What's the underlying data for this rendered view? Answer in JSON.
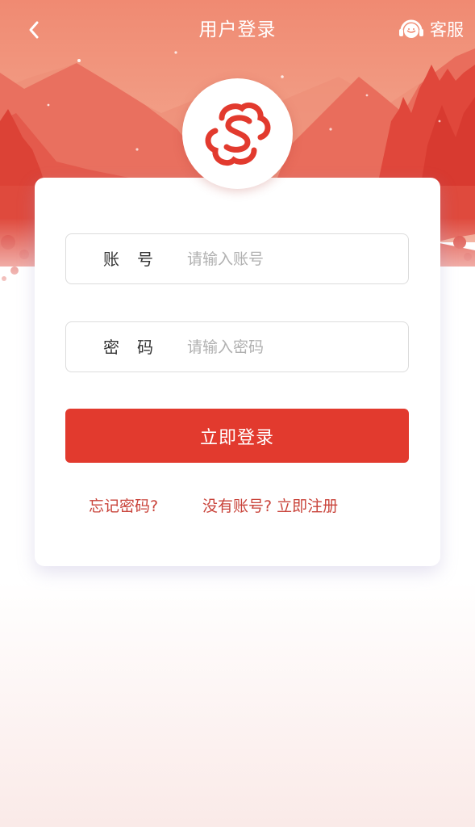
{
  "nav": {
    "title": "用户登录",
    "service_label": "客服"
  },
  "form": {
    "account_label": "账号",
    "account_placeholder": "请输入账号",
    "password_label": "密码",
    "password_placeholder": "请输入密码",
    "login_label": "立即登录",
    "forgot_label": "忘记密码?",
    "register_label": "没有账号? 立即注册"
  },
  "colors": {
    "primary": "#e23a2e",
    "link": "#c9433a",
    "hero_top": "#f28a73",
    "hero_mountain": "#e4574a"
  },
  "icons": {
    "back": "chevron-left-icon",
    "service": "headset-service-icon",
    "logo": "double-s-cloud-logo"
  }
}
